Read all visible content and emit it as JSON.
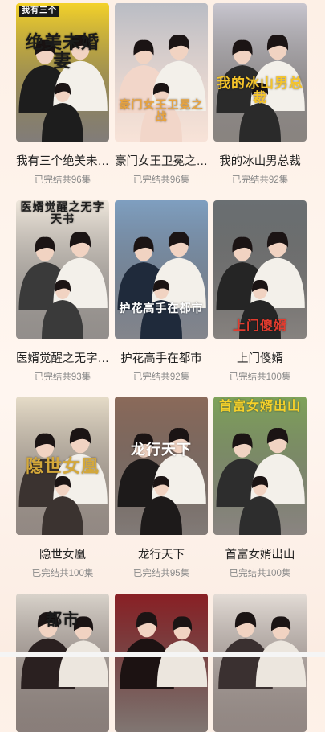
{
  "dramas": [
    {
      "title": "我有三个绝美未…",
      "status": "已完结共96集",
      "poster_text": "绝美未婚妻",
      "poster_tag": "我有三个",
      "bg": "#f4d22a",
      "accent": "#1d1d1d",
      "text_color": "#1a1a1a"
    },
    {
      "title": "豪门女王卫冕之…",
      "status": "已完结共96集",
      "poster_text": "豪门女王卫冕之战",
      "poster_tag": "",
      "bg": "#b9bcc4",
      "accent": "#f2d6c9",
      "text_color": "#e8a33d"
    },
    {
      "title": "我的冰山男总裁",
      "status": "已完结共92集",
      "poster_text": "我的冰山男总裁",
      "poster_tag": "",
      "bg": "#c8c6cf",
      "accent": "#2a2a2a",
      "text_color": "#f6c52a"
    },
    {
      "title": "医婿觉醒之无字…",
      "status": "已完结共93集",
      "poster_text": "医婿觉醒之无字天书",
      "poster_tag": "",
      "bg": "#efe7dc",
      "accent": "#3a3a3a",
      "text_color": "#1c1c1c"
    },
    {
      "title": "护花高手在都市",
      "status": "已完结共92集",
      "poster_text": "护花高手在都市",
      "poster_tag": "",
      "bg": "#7f9fc0",
      "accent": "#1f2a3b",
      "text_color": "#ffffff"
    },
    {
      "title": "上门傻婿",
      "status": "已完结共100集",
      "poster_text": "上门傻婿",
      "poster_tag": "",
      "bg": "#6a6f72",
      "accent": "#252525",
      "text_color": "#e23b2e"
    },
    {
      "title": "隐世女凰",
      "status": "已完结共100集",
      "poster_text": "隐世女凰",
      "poster_tag": "",
      "bg": "#e6dcc8",
      "accent": "#3b3330",
      "text_color": "#d4a83a"
    },
    {
      "title": "龙行天下",
      "status": "已完结共95集",
      "poster_text": "龙行天下",
      "poster_tag": "",
      "bg": "#8b6a5a",
      "accent": "#1d1a1a",
      "text_color": "#ffffff"
    },
    {
      "title": "首富女婿出山",
      "status": "已完结共100集",
      "poster_text": "首富女婿出山",
      "poster_tag": "",
      "bg": "#7fa35a",
      "accent": "#2d2d2d",
      "text_color": "#f6d12a"
    },
    {
      "title": "",
      "status": "",
      "poster_text": "都市",
      "poster_tag": "",
      "bg": "#d9d3cb",
      "accent": "#2a2020",
      "text_color": "#1a1a1a"
    },
    {
      "title": "",
      "status": "",
      "poster_text": "",
      "poster_tag": "",
      "bg": "#8a1f24",
      "accent": "#1c1212",
      "text_color": "#ffffff"
    },
    {
      "title": "",
      "status": "",
      "poster_text": "",
      "poster_tag": "",
      "bg": "#e4ddd7",
      "accent": "#3a3030",
      "text_color": "#ffffff"
    }
  ]
}
